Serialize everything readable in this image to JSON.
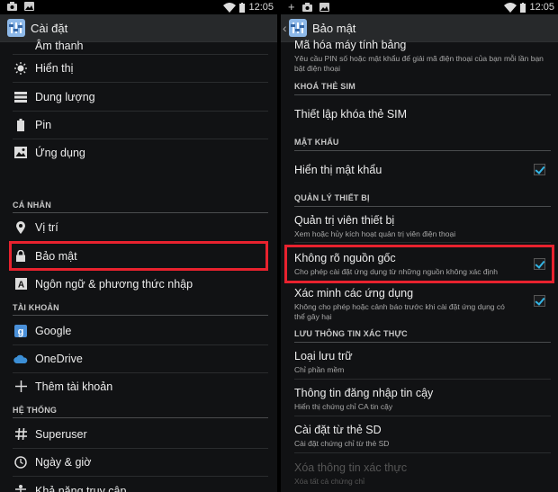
{
  "status_bar": {
    "time": "12:05",
    "plus": "+"
  },
  "left": {
    "title": "Cài đặt",
    "partial_top_label": "Âm thanh",
    "items_top": [
      {
        "label": "Hiển thị",
        "icon": "brightness-icon"
      },
      {
        "label": "Dung lượng",
        "icon": "storage-icon"
      },
      {
        "label": "Pin",
        "icon": "battery-icon"
      },
      {
        "label": "Ứng dụng",
        "icon": "apps-icon"
      }
    ],
    "section_personal": "CÁ NHÂN",
    "items_personal": [
      {
        "label": "Vị trí",
        "icon": "location-icon"
      },
      {
        "label": "Bảo mật",
        "icon": "lock-icon"
      },
      {
        "label": "Ngôn ngữ & phương thức nhập",
        "icon": "language-icon"
      }
    ],
    "section_accounts": "TÀI KHOẢN",
    "items_accounts": [
      {
        "label": "Google",
        "icon": "google-icon"
      },
      {
        "label": "OneDrive",
        "icon": "onedrive-icon"
      },
      {
        "label": "Thêm tài khoản",
        "icon": "add-icon"
      }
    ],
    "section_system": "HỆ THỐNG",
    "items_system": [
      {
        "label": "Superuser",
        "icon": "hash-icon"
      },
      {
        "label": "Ngày & giờ",
        "icon": "clock-icon"
      },
      {
        "label": "Khả năng truy cập",
        "icon": "accessibility-icon"
      }
    ]
  },
  "right": {
    "title": "Bảo mật",
    "encrypt": {
      "title": "Mã hóa máy tính bảng",
      "subtitle": "Yêu cầu PIN số hoặc mật khẩu để giải mã điện thoại của bạn mỗi lần bạn bật điện thoại"
    },
    "section_sim": "KHOÁ THẺ SIM",
    "sim_lock": "Thiết lập khóa thẻ SIM",
    "section_password": "MẬT KHẨU",
    "show_password": {
      "title": "Hiển thị mật khẩu",
      "checked": true
    },
    "section_device": "QUẢN LÝ THIẾT BỊ",
    "device_admin": {
      "title": "Quản trị viên thiết bị",
      "subtitle": "Xem hoặc hủy kích hoạt quản trị viên điện thoại"
    },
    "unknown_sources": {
      "title": "Không rõ nguồn gốc",
      "subtitle": "Cho phép cài đặt ứng dụng từ những nguồn không xác định",
      "checked": true
    },
    "verify_apps": {
      "title": "Xác minh các ứng dụng",
      "subtitle": "Không cho phép hoặc cảnh báo trước khi cài đặt ứng dụng có thể gây hại",
      "checked": true
    },
    "section_credentials": "LƯU THÔNG TIN XÁC THỰC",
    "storage_type": {
      "title": "Loại lưu trữ",
      "subtitle": "Chỉ phần mềm"
    },
    "trusted_credentials": {
      "title": "Thông tin đăng nhập tin cậy",
      "subtitle": "Hiển thị chứng chỉ CA tin cậy"
    },
    "install_sd": {
      "title": "Cài đặt từ thẻ SD",
      "subtitle": "Cài đặt chứng chỉ từ thẻ SD"
    },
    "clear_credentials": {
      "title": "Xóa thông tin xác thực",
      "subtitle": "Xóa tất cả chứng chỉ"
    }
  },
  "colors": {
    "highlight": "#e8222e",
    "accent": "#33b5e5",
    "background": "#111214"
  }
}
